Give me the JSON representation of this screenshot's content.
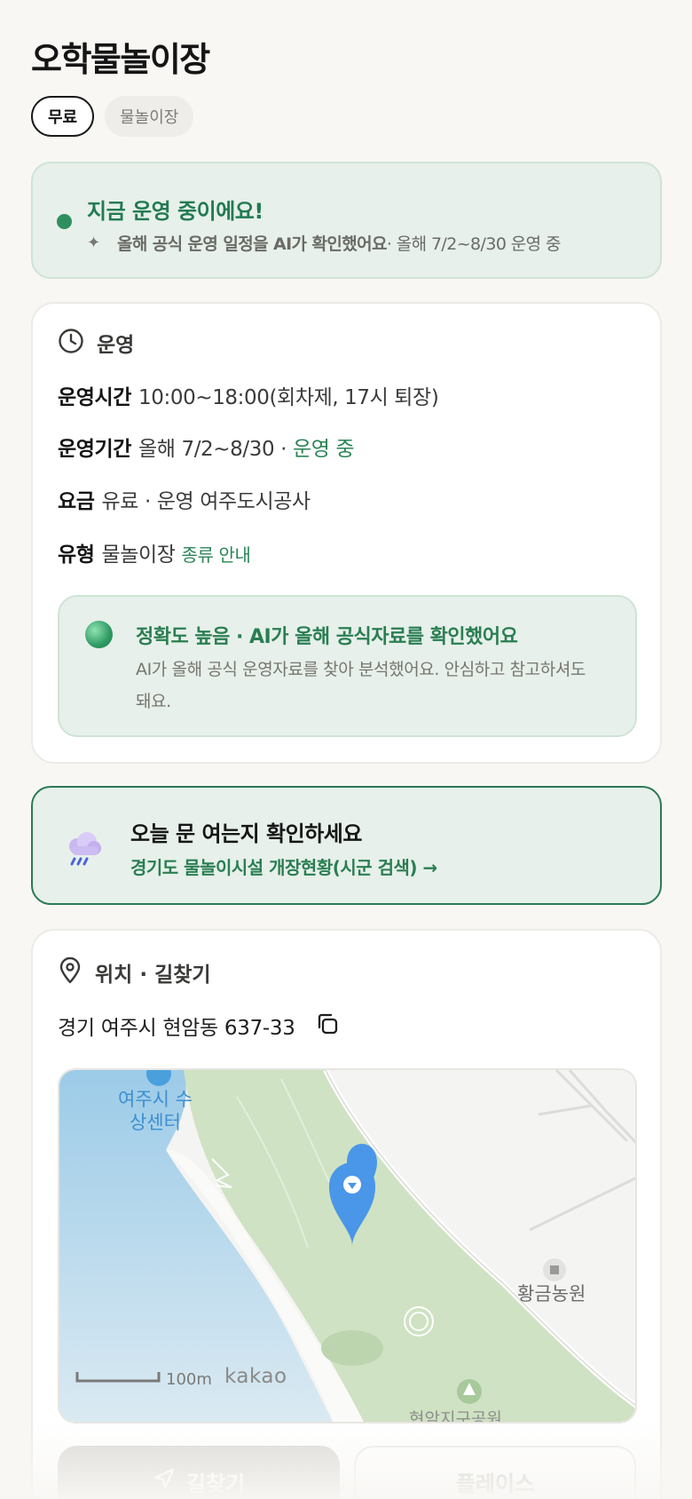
{
  "title": "오학물놀이장",
  "chips": {
    "free": "무료",
    "type": "물놀이장"
  },
  "status": {
    "headline": "지금 운영 중이에요!",
    "ai_note": "올해 공식 운영 일정을 AI가 확인했어요",
    "detail": " · 올해 7/2~8/30 운영 중"
  },
  "operation": {
    "section_label": "운영",
    "hours_key": "운영시간",
    "hours_value": "10:00~18:00(회차제, 17시 퇴장)",
    "period_key": "운영기간",
    "period_value": "올해 7/2~8/30 · ",
    "period_status": "운영 중",
    "fee_key": "요금",
    "fee_value": "유료 · 운영 여주도시공사",
    "type_key": "유형",
    "type_value": "물놀이장",
    "type_link": "종류 안내"
  },
  "accuracy": {
    "headline": "정확도 높음 · AI가 올해 공식자료를 확인했어요",
    "body": "AI가 올해 공식 운영자료를 찾아 분석했어요. 안심하고 참고하셔도 돼요."
  },
  "check_today": {
    "headline": "오늘 문 여는지 확인하세요",
    "link": "경기도 물놀이시설 개장현황(시군 검색) →"
  },
  "location": {
    "section_label": "위치 · 길찾기",
    "address": "경기 여주시 현암동 637-33",
    "map": {
      "label_center": "여주시 수상센터",
      "label_farm": "황금농원",
      "label_park": "현암지구공원",
      "scale": "100m",
      "provider": "kakao"
    }
  },
  "buttons": {
    "route": "길찾기",
    "place": "플레이스"
  },
  "colors": {
    "accent_green": "#2a8456",
    "banner_bg": "#e7f0ea",
    "page_bg": "#f8f7f4"
  }
}
